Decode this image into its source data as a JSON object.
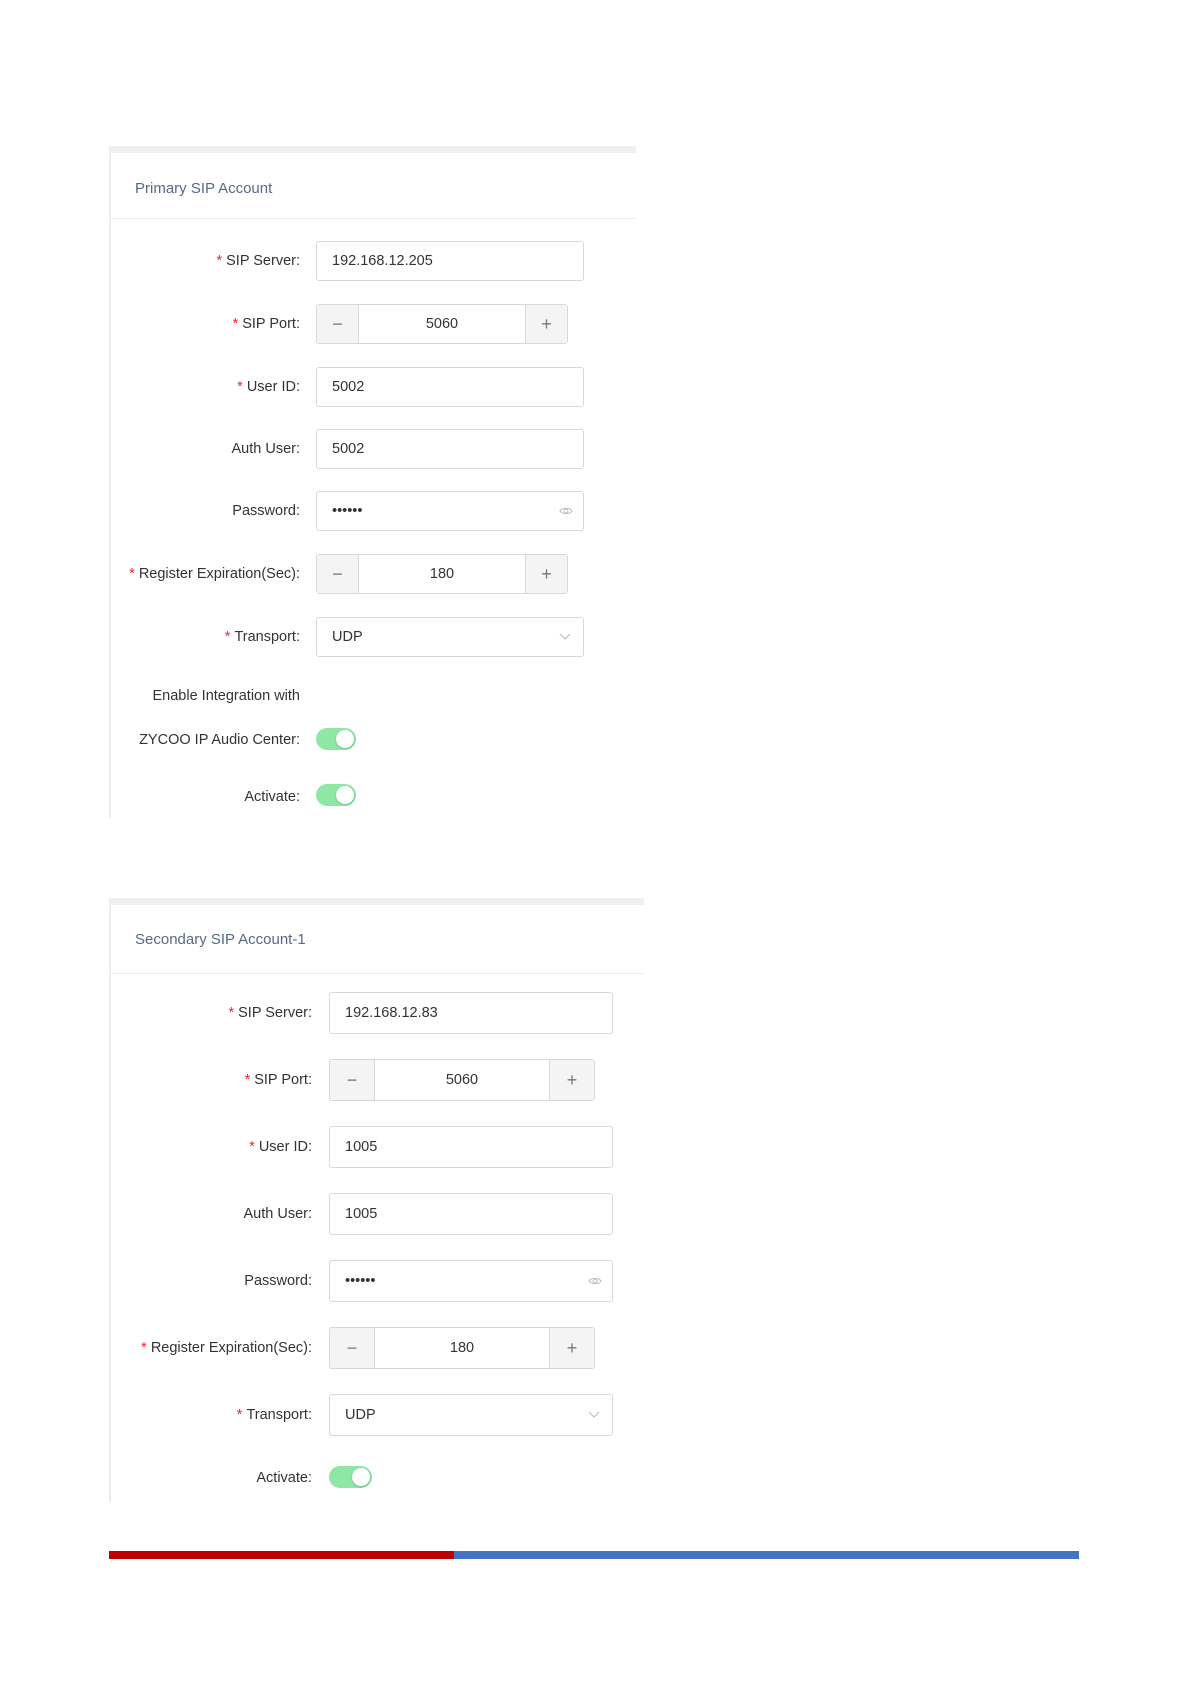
{
  "primary": {
    "title": "Primary SIP Account",
    "sip_server": {
      "label": "SIP Server:",
      "value": "192.168.12.205"
    },
    "sip_port": {
      "label": "SIP Port:",
      "value": "5060"
    },
    "user_id": {
      "label": "User ID:",
      "value": "5002"
    },
    "auth_user": {
      "label": "Auth User:",
      "value": "5002"
    },
    "password": {
      "label": "Password:",
      "value": "••••••"
    },
    "register_expiration": {
      "label": "Register Expiration(Sec):",
      "value": "180"
    },
    "transport": {
      "label": "Transport:",
      "value": "UDP"
    },
    "integration": {
      "label_line1": "Enable Integration with",
      "label_line2": "ZYCOO IP Audio Center:",
      "enabled": true
    },
    "activate": {
      "label": "Activate:",
      "enabled": true
    }
  },
  "secondary": {
    "title": "Secondary SIP Account-1",
    "sip_server": {
      "label": "SIP Server:",
      "value": "192.168.12.83"
    },
    "sip_port": {
      "label": "SIP Port:",
      "value": "5060"
    },
    "user_id": {
      "label": "User ID:",
      "value": "1005"
    },
    "auth_user": {
      "label": "Auth User:",
      "value": "1005"
    },
    "password": {
      "label": "Password:",
      "value": "••••••"
    },
    "register_expiration": {
      "label": "Register Expiration(Sec):",
      "value": "180"
    },
    "transport": {
      "label": "Transport:",
      "value": "UDP"
    },
    "activate": {
      "label": "Activate:",
      "enabled": true
    }
  },
  "common": {
    "required_mark": "*",
    "minus_symbol": "−",
    "plus_symbol": "+"
  },
  "theme": {
    "toggle_on": "#8ee7a5",
    "footer_red": "#c00000",
    "footer_blue": "#4472c4",
    "title_color": "#556a86"
  },
  "icons": {
    "password_toggle": "eye-icon",
    "select_arrow": "chevron-down-icon"
  }
}
